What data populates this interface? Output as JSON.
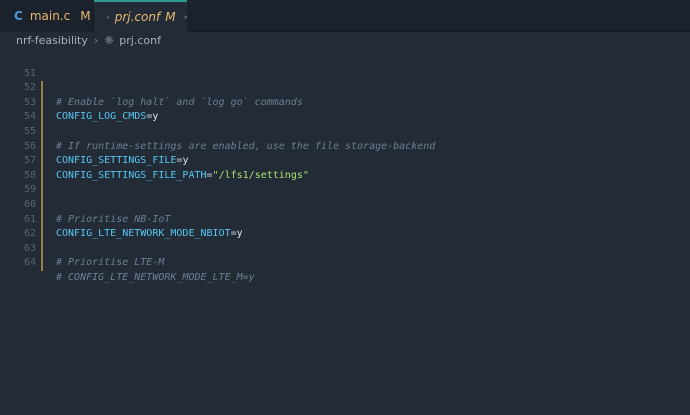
{
  "tabs": [
    {
      "lang_icon": "C",
      "label": "main.c",
      "modified": "M"
    },
    {
      "label": "prj.conf",
      "modified": "M"
    }
  ],
  "breadcrumb": {
    "folder": "nrf-feasibility",
    "file": "prj.conf"
  },
  "editor": {
    "lines": [
      {
        "number": "51",
        "comment": "# Enable `log halt` and `log go` commands"
      },
      {
        "number": "52",
        "key": "CONFIG_LOG_CMDS",
        "op": "=",
        "value": "y"
      },
      {
        "number": "53"
      },
      {
        "number": "54",
        "comment": "# If runtime-settings are enabled, use the file storage-backend"
      },
      {
        "number": "55",
        "key": "CONFIG_SETTINGS_FILE",
        "op": "=",
        "value": "y"
      },
      {
        "number": "56",
        "key": "CONFIG_SETTINGS_FILE_PATH",
        "op": "=",
        "string": "\"/lfs1/settings\""
      },
      {
        "number": "57"
      },
      {
        "number": "58"
      },
      {
        "number": "59",
        "comment": "# Prioritise NB-IoT"
      },
      {
        "number": "60",
        "key": "CONFIG_LTE_NETWORK_MODE_NBIOT",
        "op": "=",
        "value": "y"
      },
      {
        "number": "61"
      },
      {
        "number": "62",
        "comment": "# Prioritise LTE-M"
      },
      {
        "number": "63",
        "comment": "# CONFIG_LTE_NETWORK_MODE_LTE_M=y"
      },
      {
        "number": "64"
      }
    ]
  },
  "colors": {
    "accent_tab_border": "#2f9a8f",
    "modified": "#e6b873",
    "comment": "#6f7e95",
    "key": "#57c7f2",
    "string": "#a8e36b",
    "gutter_modified": "#9e7f3f"
  }
}
